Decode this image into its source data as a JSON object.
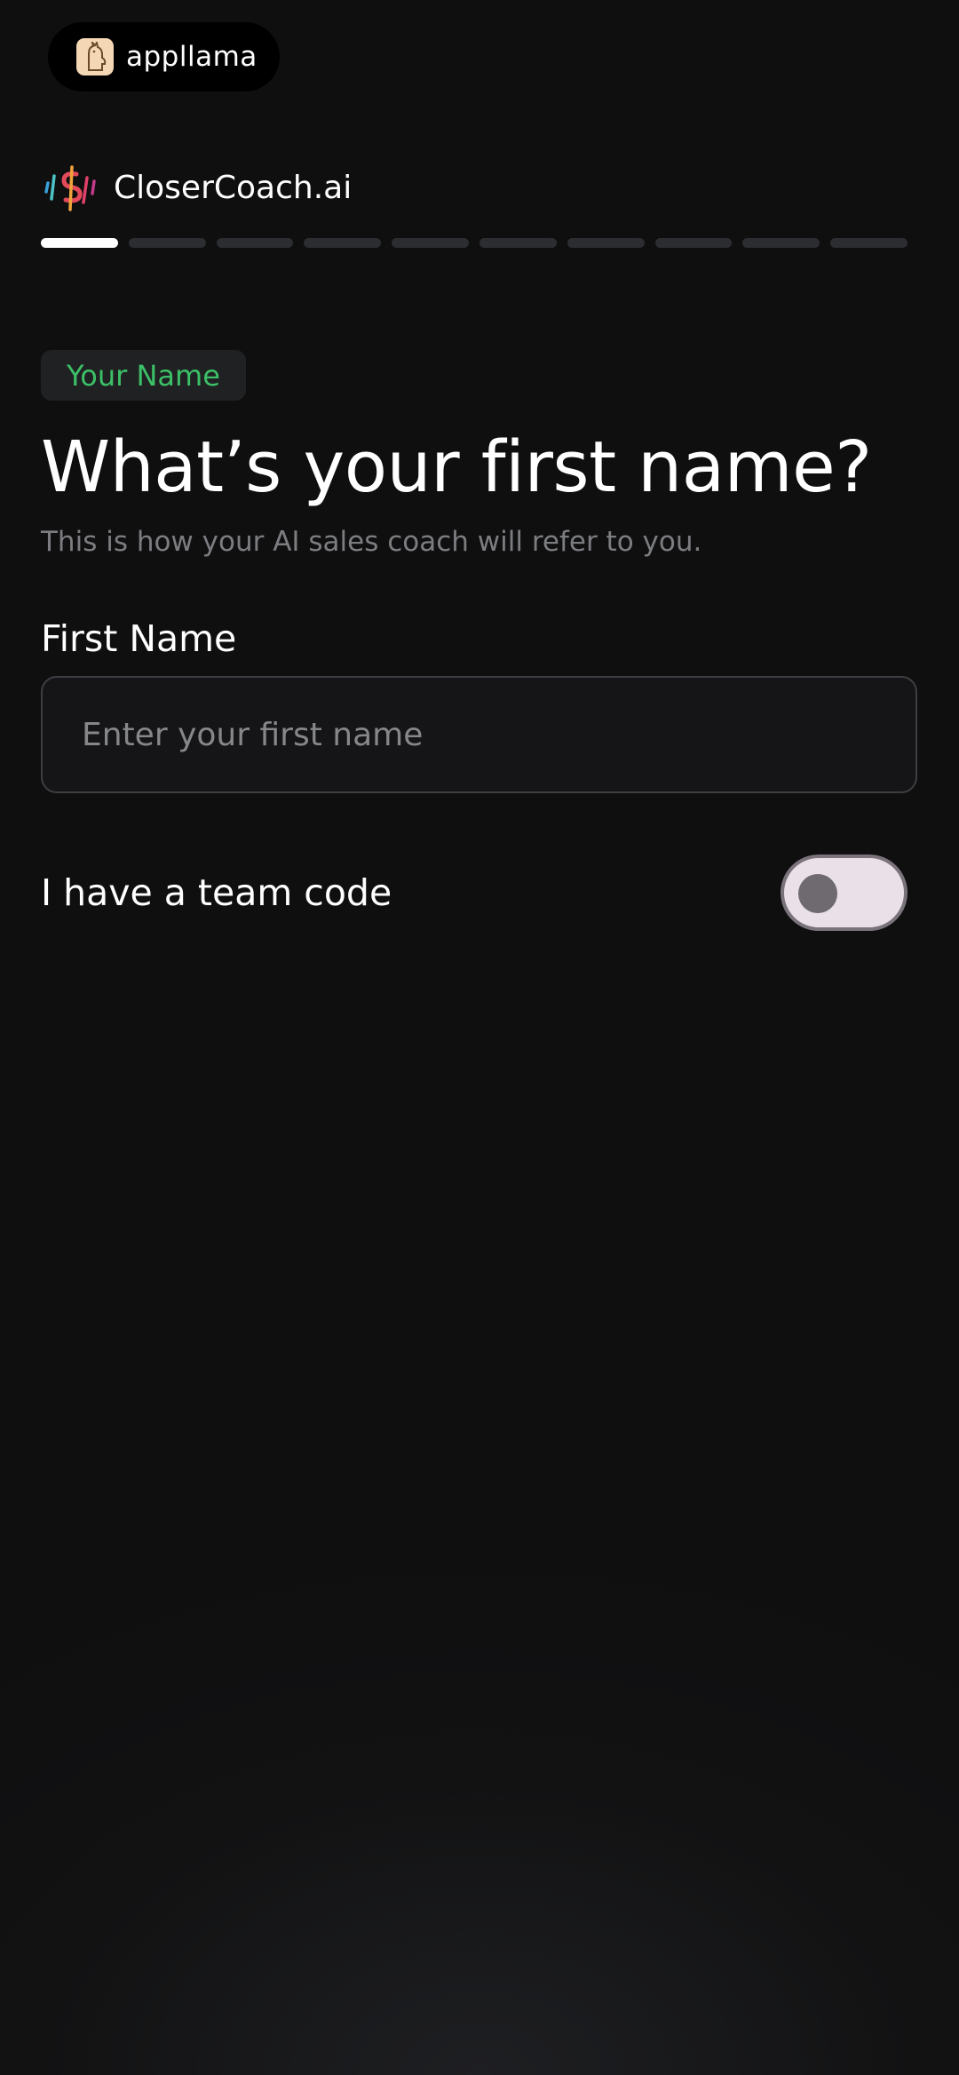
{
  "watermark": {
    "text": "appllama",
    "icon": "llama-icon"
  },
  "header": {
    "brand_name": "CloserCoach.ai",
    "logo_icon": "closercoach-logo-icon"
  },
  "progress": {
    "total_steps": 10,
    "current_step": 1
  },
  "step_chip": {
    "label": "Your Name",
    "color": "#3cc067"
  },
  "main": {
    "title": "What’s your first name?",
    "subtitle": "This is how your AI sales coach will refer to you."
  },
  "first_name": {
    "label": "First Name",
    "placeholder": "Enter your first name",
    "value": ""
  },
  "team_code": {
    "label": "I have a team code",
    "enabled": false
  }
}
